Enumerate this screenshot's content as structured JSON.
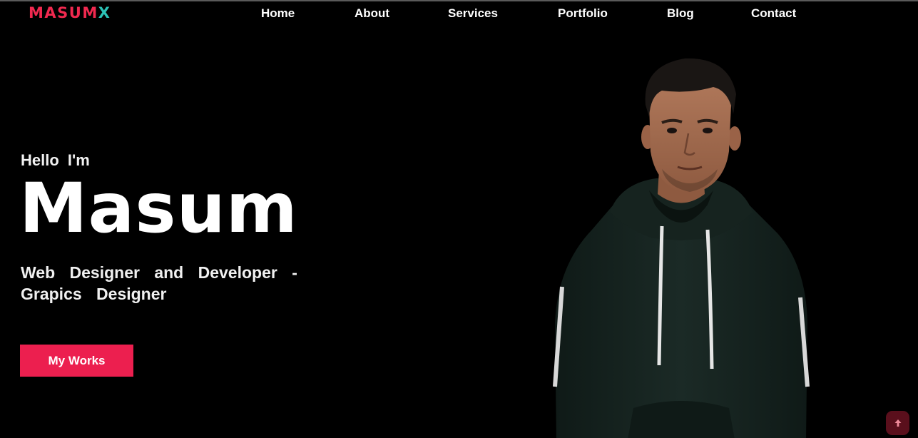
{
  "header": {
    "logo": {
      "part1": "MASUM",
      "part2": "X"
    },
    "nav": [
      {
        "label": "Home"
      },
      {
        "label": "About"
      },
      {
        "label": "Services"
      },
      {
        "label": "Portfolio"
      },
      {
        "label": "Blog"
      },
      {
        "label": "Contact"
      }
    ]
  },
  "hero": {
    "greeting": "Hello I'm",
    "name": "Masum",
    "role_line1": "Web Designer and Developer -",
    "role_line2": "Grapics Designer",
    "cta_label": "My Works"
  },
  "icons": {
    "scroll_top": "arrow-up-icon",
    "portrait": "person-photo"
  },
  "colors": {
    "background": "#000000",
    "accent": "#ec1f4f",
    "logo_primary": "#f0294f",
    "logo_secondary": "#2cc2b6",
    "scroll_button": "#5a0f1c",
    "hoodie": "#16231f"
  }
}
